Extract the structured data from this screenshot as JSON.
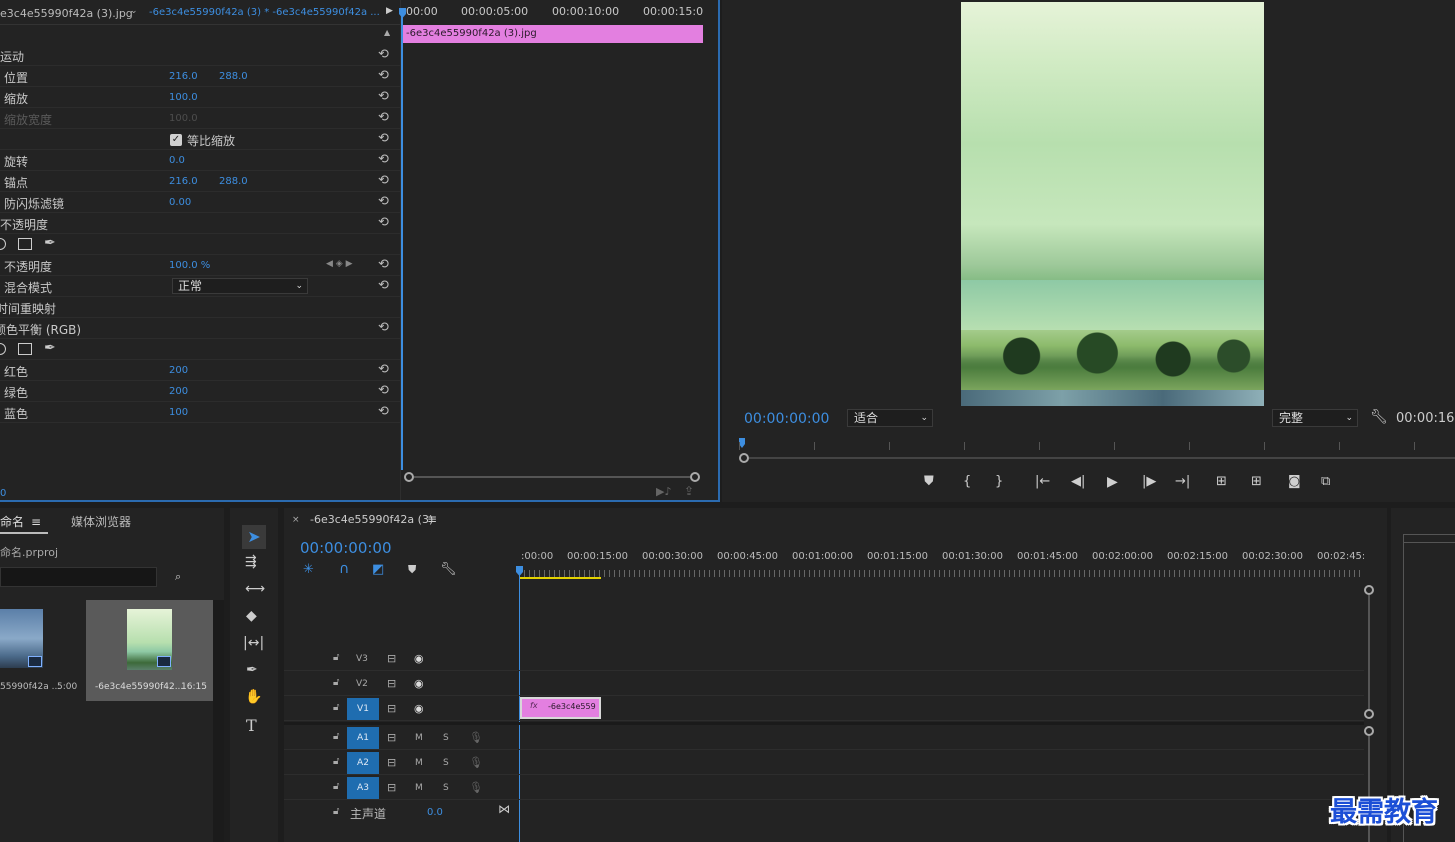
{
  "effect_controls": {
    "tab_source": "e3c4e55990f42a (3).jpg",
    "tab_sequence": "-6e3c4e55990f42a (3) * -6e3c4e55990f42a ...",
    "timecodes": [
      "00:00",
      "00:00:05:00",
      "00:00:10:00",
      "00:00:15:0("
    ],
    "clip_name": "-6e3c4e55990f42a (3).jpg",
    "motion": "运动",
    "position_label": "位置",
    "position_x": "216.0",
    "position_y": "288.0",
    "scale_label": "缩放",
    "scale_value": "100.0",
    "scale_width_label": "缩放宽度",
    "scale_width_value": "100.0",
    "uniform_scale_label": "等比缩放",
    "rotation_label": "旋转",
    "rotation_value": "0.0",
    "anchor_label": "锚点",
    "anchor_x": "216.0",
    "anchor_y": "288.0",
    "flicker_label": "防闪烁滤镜",
    "flicker_value": "0.00",
    "opacity_section": "不透明度",
    "opacity_label": "不透明度",
    "opacity_value": "100.0 %",
    "blend_label": "混合模式",
    "blend_value": "正常",
    "time_remap": "时间重映射",
    "color_balance": "颜色平衡 (RGB)",
    "red_label": "红色",
    "red_value": "200",
    "green_label": "绿色",
    "green_value": "200",
    "blue_label": "蓝色",
    "blue_value": "100",
    "bottom_time": "0"
  },
  "program_monitor": {
    "timecode": "00:00:00:00",
    "fit": "适合",
    "quality": "完整",
    "duration": "00:00:16:"
  },
  "project": {
    "tab_name": "命名",
    "tab_media": "媒体浏览器",
    "file": "命名.prproj",
    "items": [
      {
        "name": "55990f42a ...",
        "duration": "5:00"
      },
      {
        "name": "-6e3c4e55990f42...",
        "duration": "16:15"
      }
    ]
  },
  "timeline": {
    "seq_name": "-6e3c4e55990f42a (3)",
    "timecode": "00:00:00:00",
    "ruler": [
      ":00:00",
      "00:00:15:00",
      "00:00:30:00",
      "00:00:45:00",
      "00:01:00:00",
      "00:01:15:00",
      "00:01:30:00",
      "00:01:45:00",
      "00:02:00:00",
      "00:02:15:00",
      "00:02:30:00",
      "00:02:45:"
    ],
    "tracks": [
      "V3",
      "V2",
      "V1",
      "A1",
      "A2",
      "A3"
    ],
    "m": "M",
    "s": "S",
    "master_label": "主声道",
    "master_value": "0.0",
    "clip_label": "-6e3c4e559"
  },
  "watermark": "最需教育",
  "colors": {
    "accent": "#3d8ee0",
    "clip": "#e37fe0",
    "track_blue": "#1f6db0"
  }
}
